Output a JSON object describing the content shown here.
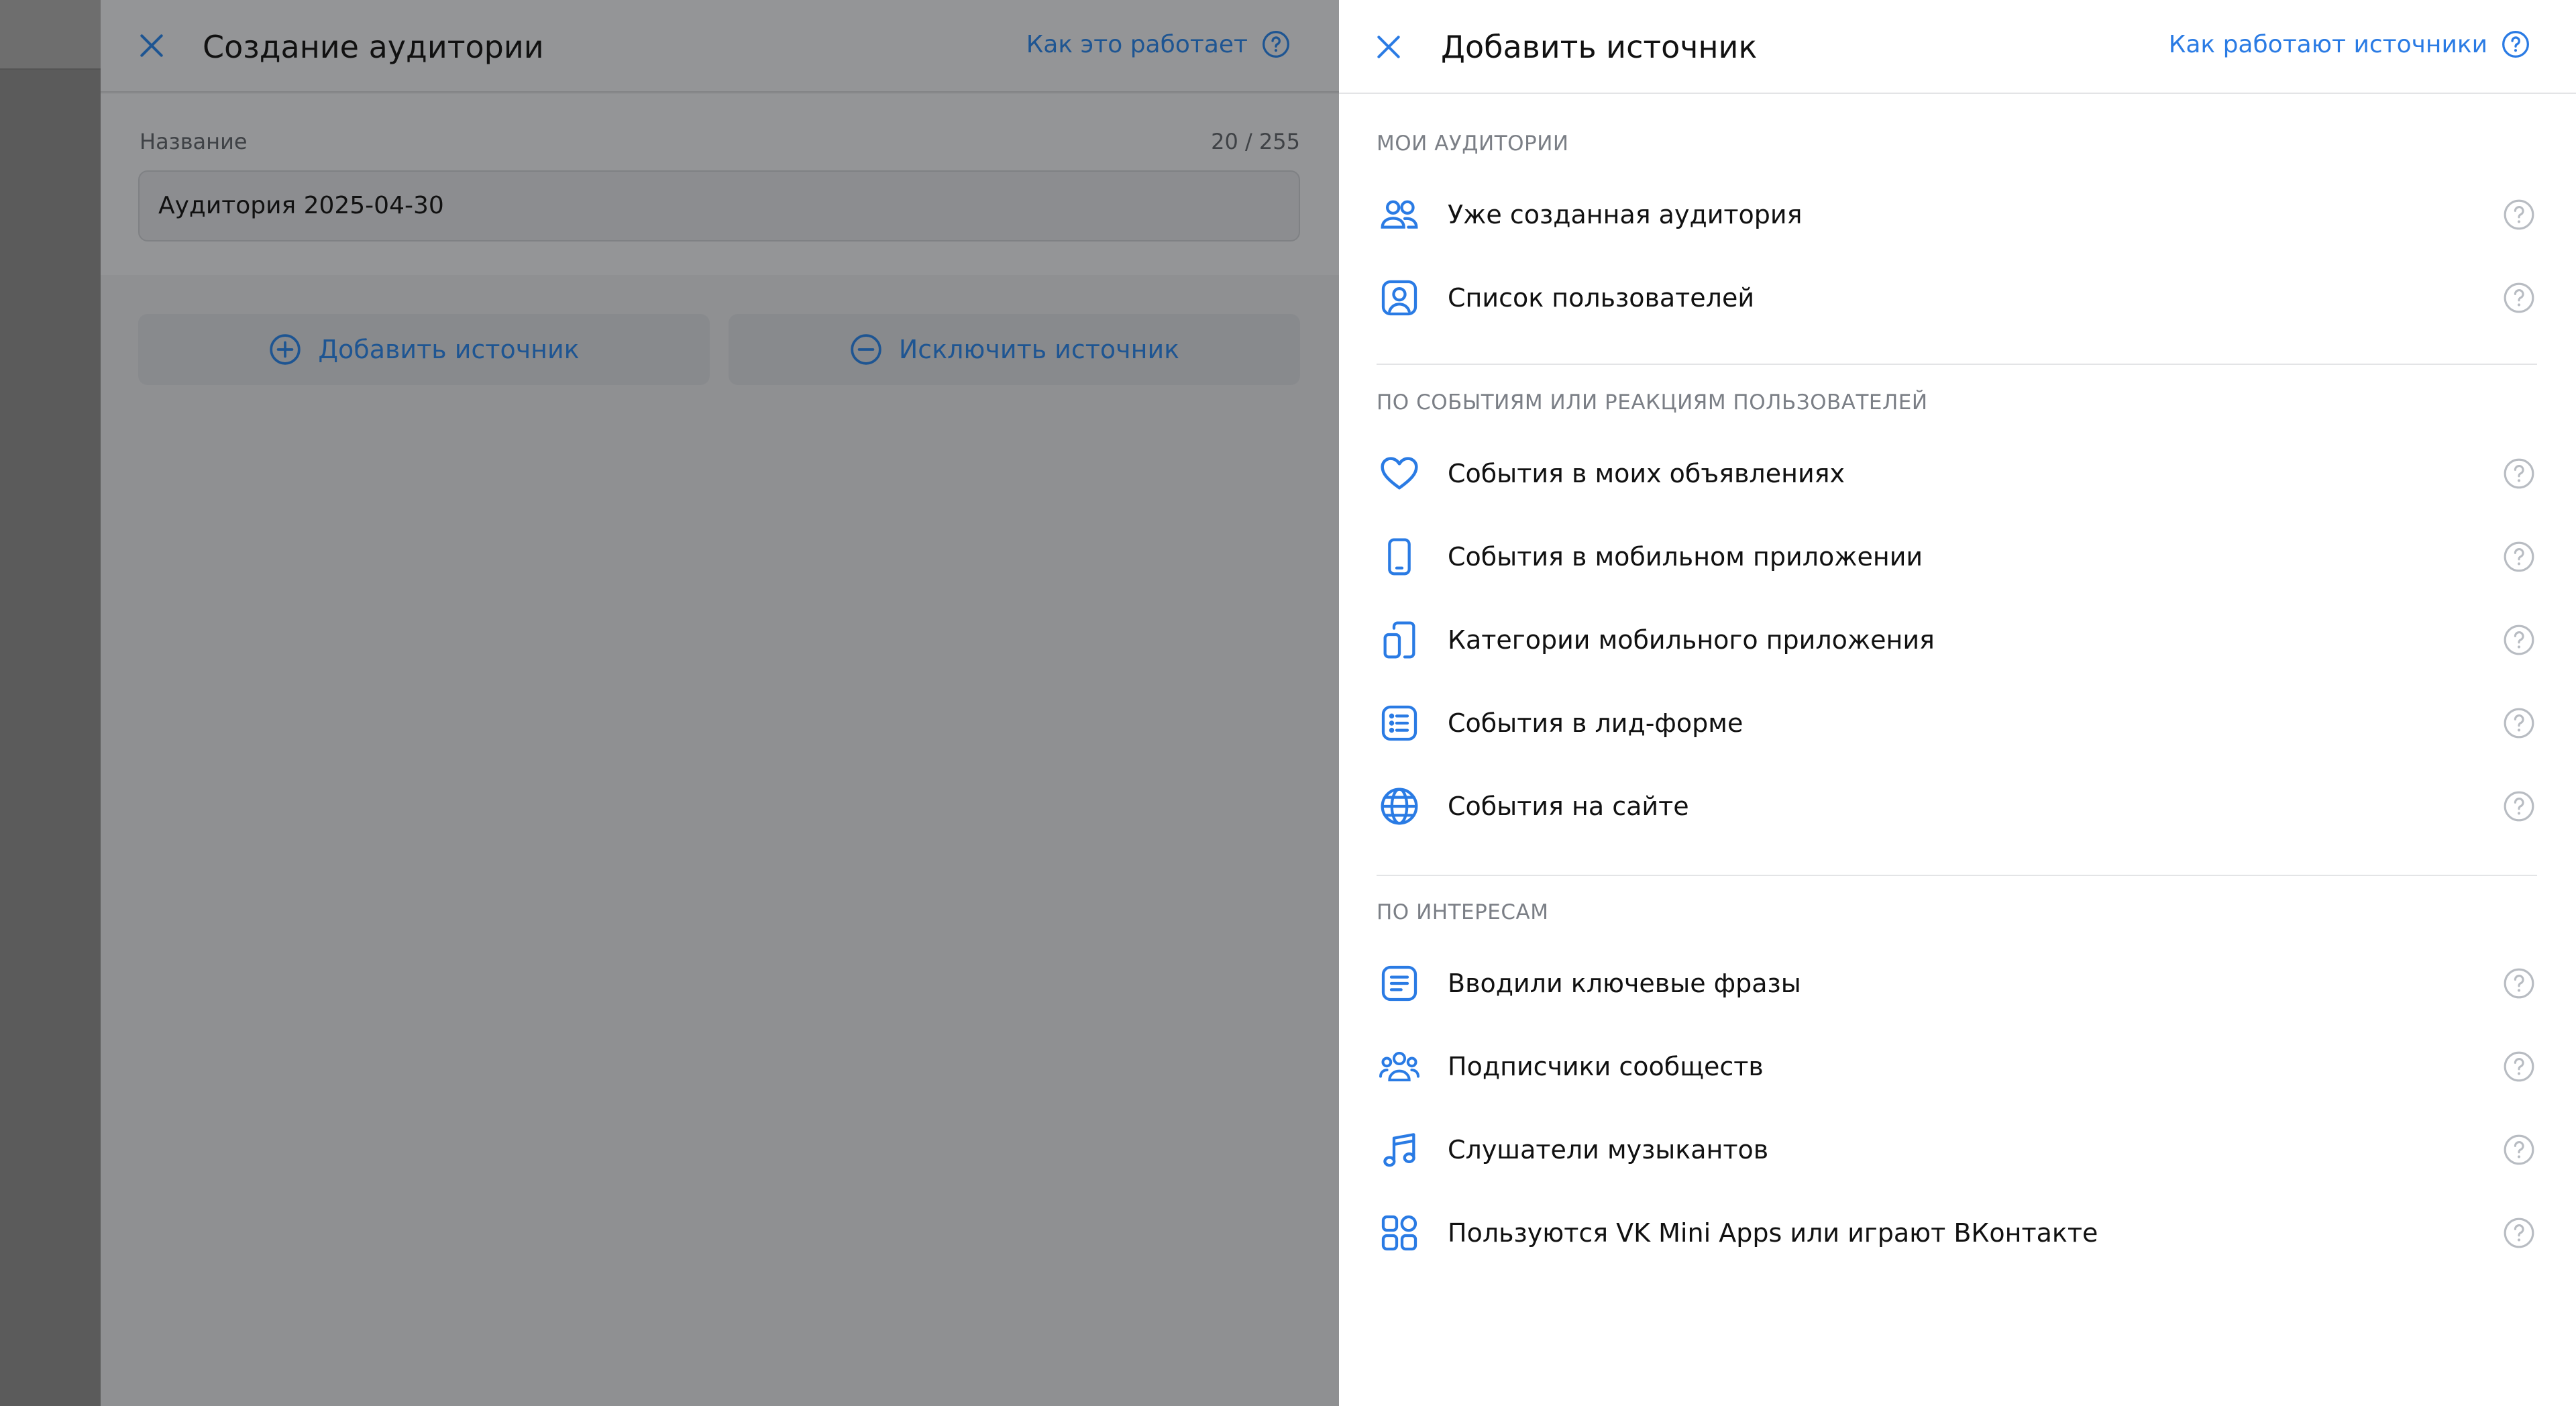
{
  "underlying": {
    "title": "Создание аудитории",
    "help_link": "Как это работает",
    "name_label": "Название",
    "name_counter": "20 / 255",
    "name_value": "Аудитория 2025-04-30",
    "add_source_label": "Добавить источник",
    "exclude_source_label": "Исключить источник"
  },
  "drawer": {
    "title": "Добавить источник",
    "help_link": "Как работают источники",
    "sections": [
      {
        "title": "МОИ АУДИТОРИИ",
        "items": [
          {
            "label": "Уже созданная аудитория",
            "icon": "users-icon"
          },
          {
            "label": "Список пользователей",
            "icon": "user-card-icon"
          }
        ]
      },
      {
        "title": "ПО СОБЫТИЯМ ИЛИ РЕАКЦИЯМ ПОЛЬЗОВАТЕЛЕЙ",
        "items": [
          {
            "label": "События в моих объявлениях",
            "icon": "heart-icon"
          },
          {
            "label": "События в мобильном приложении",
            "icon": "smartphone-icon"
          },
          {
            "label": "Категории мобильного приложения",
            "icon": "devices-icon"
          },
          {
            "label": "События в лид-форме",
            "icon": "list-icon"
          },
          {
            "label": "События на сайте",
            "icon": "globe-icon"
          }
        ]
      },
      {
        "title": "ПО ИНТЕРЕСАМ",
        "items": [
          {
            "label": "Вводили ключевые фразы",
            "icon": "text-lines-icon"
          },
          {
            "label": "Подписчики сообществ",
            "icon": "community-icon"
          },
          {
            "label": "Слушатели музыкантов",
            "icon": "music-note-icon"
          },
          {
            "label": "Пользуются VK Mini Apps или играют ВКонтакте",
            "icon": "apps-grid-icon"
          }
        ]
      }
    ]
  },
  "colors": {
    "accent": "#2a7be4",
    "text": "#111111",
    "muted": "#7b7f86",
    "help_icon": "#b8bcc2",
    "overlay": "#8f9092"
  }
}
